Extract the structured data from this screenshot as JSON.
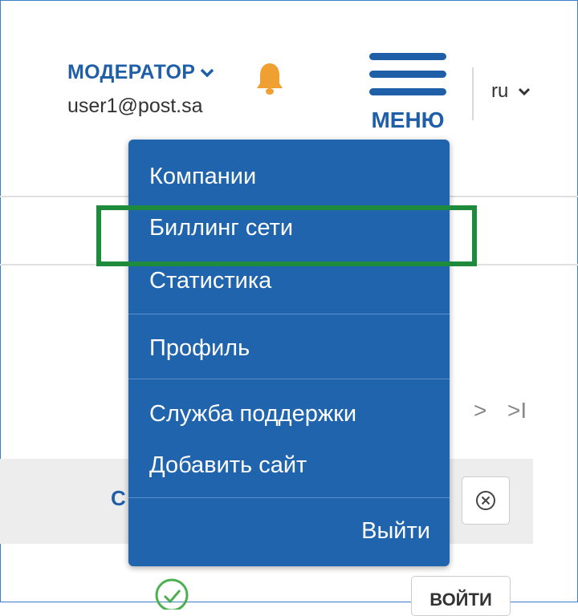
{
  "header": {
    "role_label": "МОДЕРАТОР",
    "user_email": "user1@post.sa",
    "menu_label": "МЕНЮ",
    "language": "ru"
  },
  "dropdown": {
    "items": [
      {
        "label": "Компании"
      },
      {
        "label": "Биллинг сети"
      },
      {
        "label": "Статистика"
      },
      {
        "label": "Профиль"
      },
      {
        "label": "Служба поддержки"
      },
      {
        "label": "Добавить сайт"
      }
    ],
    "logout_label": "Выйти"
  },
  "background": {
    "pager_next": ">",
    "pager_last": ">I",
    "column_letter": "С",
    "login_button": "ВОЙТИ"
  },
  "colors": {
    "accent": "#1f5fa8",
    "menu_bg": "#1f64ad",
    "highlight": "#1e8a3c",
    "bell": "#f0a030"
  },
  "icons": [
    "chevron-down-icon",
    "bell-icon",
    "hamburger-icon",
    "clear-circle-icon",
    "check-circle-icon"
  ]
}
